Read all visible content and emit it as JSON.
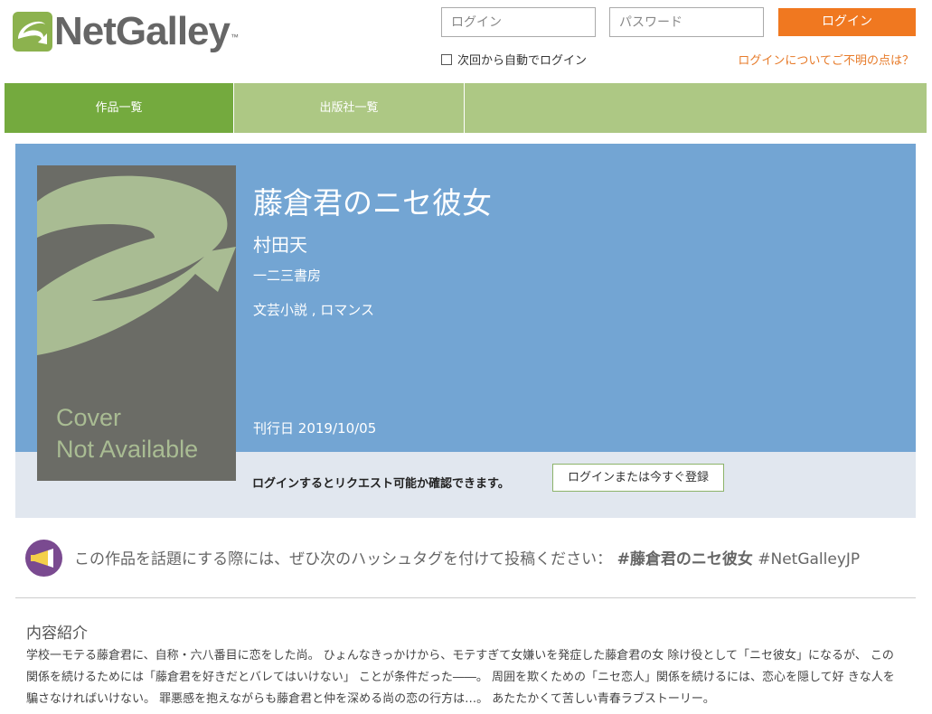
{
  "header": {
    "logo_text": "NetGalley",
    "logo_tm": "™",
    "username_placeholder": "ログイン",
    "password_placeholder": "パスワード",
    "login_button": "ログイン",
    "remember_label": "次回から自動でログイン",
    "help_link": "ログインについてご不明の点は？"
  },
  "nav": {
    "tabs": [
      {
        "label": "作品一覧"
      },
      {
        "label": "出版社一覧"
      }
    ]
  },
  "book": {
    "cover_line1": "Cover",
    "cover_line2": "Not Available",
    "title": "藤倉君のニセ彼女",
    "author": "村田天",
    "publisher": "一二三書房",
    "genre": "文芸小説 , ロマンス",
    "date_label": "刊行日",
    "date": "2019/10/05",
    "request_note": "ログインするとリクエスト可能か確認できます。",
    "register_button": "ログインまたは今すぐ登録"
  },
  "hashtag": {
    "text": "この作品を話題にする際には、ぜひ次のハッシュタグを付けて投稿ください：",
    "tag1": "#藤倉君のニセ彼女",
    "tag2": "#NetGalleyJP"
  },
  "description": {
    "heading": "内容紹介",
    "body": "学校一モテる藤倉君に、自称・六八番目に恋をした尚。 ひょんなきっかけから、モテすぎて女嫌いを発症した藤倉君の女 除け役として「ニセ彼女」になるが、 この関係を続けるためには「藤倉君を好きだとバレてはいけない」 ことが条件だった――。 周囲を欺くための「ニセ恋人」関係を続けるには、恋心を隠して好 きな人を騙さなければいけない。 罪悪感を抱えながらも藤倉君と仲を深める尚の恋の行方は…。 あたたかくて苦しい青春ラブストーリー。"
  },
  "colors": {
    "nav_active": "#74aa3e",
    "nav_bg": "#adc884",
    "hero_bg": "#73a5d3",
    "login_button": "#f07820",
    "hashtag_icon": "#7a4a90"
  }
}
